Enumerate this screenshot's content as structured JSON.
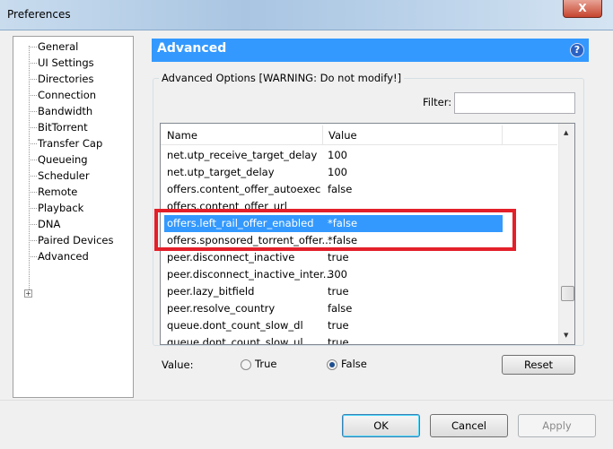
{
  "window": {
    "title": "Preferences",
    "close_label": "X"
  },
  "sidebar": {
    "items": [
      {
        "label": "General"
      },
      {
        "label": "UI Settings"
      },
      {
        "label": "Directories"
      },
      {
        "label": "Connection"
      },
      {
        "label": "Bandwidth"
      },
      {
        "label": "BitTorrent"
      },
      {
        "label": "Transfer Cap"
      },
      {
        "label": "Queueing"
      },
      {
        "label": "Scheduler"
      },
      {
        "label": "Remote"
      },
      {
        "label": "Playback"
      },
      {
        "label": "DNA"
      },
      {
        "label": "Paired Devices"
      },
      {
        "label": "Advanced"
      }
    ],
    "expand_label": "+"
  },
  "header": {
    "title": "Advanced",
    "help_label": "?"
  },
  "group": {
    "label": "Advanced Options [WARNING: Do not modify!]",
    "filter_label": "Filter:",
    "filter_value": ""
  },
  "table": {
    "columns": [
      "Name",
      "Value"
    ],
    "rows": [
      {
        "name": "net.utp_receive_target_delay",
        "value": "100"
      },
      {
        "name": "net.utp_target_delay",
        "value": "100"
      },
      {
        "name": "offers.content_offer_autoexec",
        "value": "false"
      },
      {
        "name": "offers.content_offer_url",
        "value": ""
      },
      {
        "name": "offers.left_rail_offer_enabled",
        "value": "*false",
        "selected": true
      },
      {
        "name": "offers.sponsored_torrent_offer...",
        "value": "*false"
      },
      {
        "name": "peer.disconnect_inactive",
        "value": "true"
      },
      {
        "name": "peer.disconnect_inactive_inter...",
        "value": "300"
      },
      {
        "name": "peer.lazy_bitfield",
        "value": "true"
      },
      {
        "name": "peer.resolve_country",
        "value": "false"
      },
      {
        "name": "queue.dont_count_slow_dl",
        "value": "true"
      },
      {
        "name": "queue.dont_count_slow_ul",
        "value": "true"
      }
    ]
  },
  "value_editor": {
    "label": "Value:",
    "true_label": "True",
    "false_label": "False",
    "selected": "False",
    "reset_label": "Reset"
  },
  "footer": {
    "ok_label": "OK",
    "cancel_label": "Cancel",
    "apply_label": "Apply"
  },
  "colors": {
    "accent": "#3399ff",
    "highlight_box": "#e3202a"
  }
}
